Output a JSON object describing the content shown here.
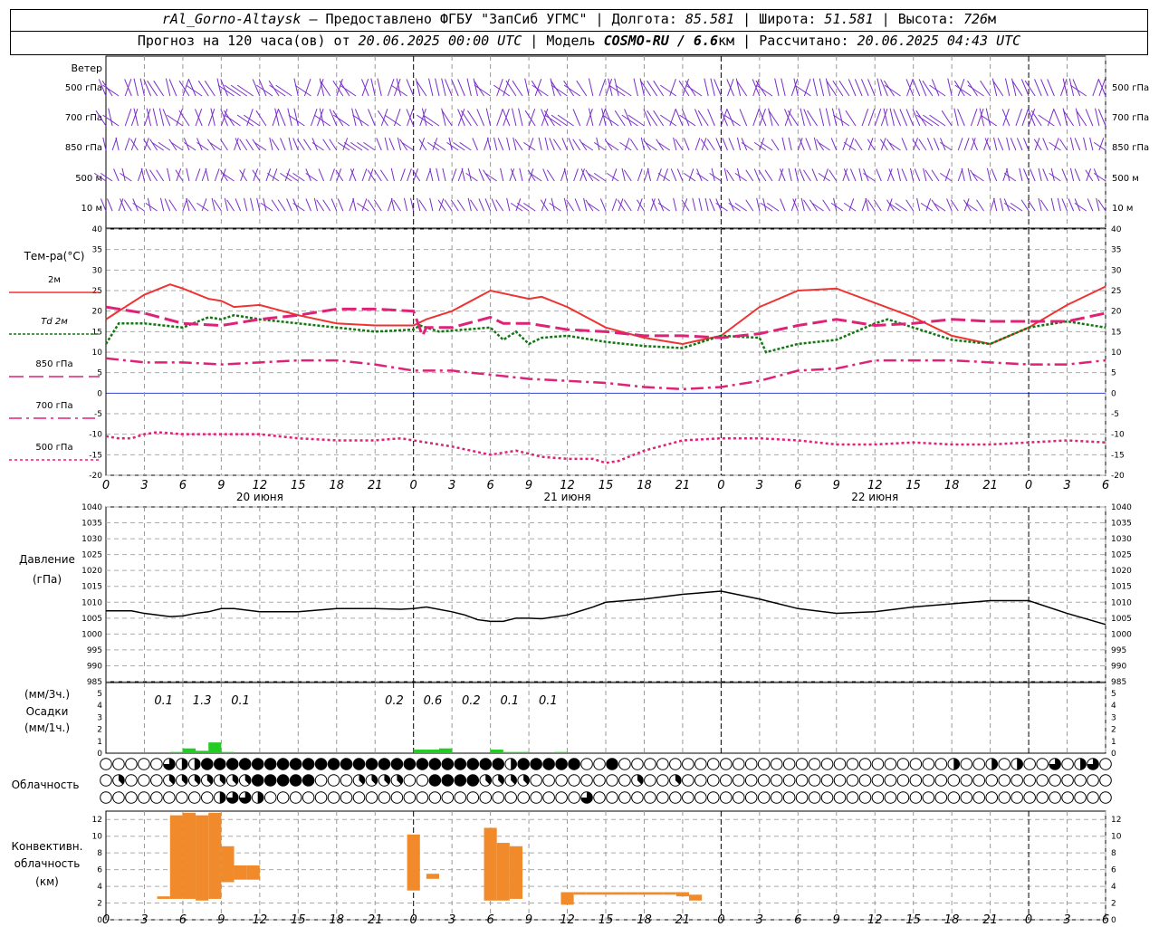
{
  "header": {
    "station": "rAl_Gorno-Altaysk",
    "provider": "— Предоставлено ФГБУ \"ЗапСиб УГМС\"",
    "lon_label": "Долгота:",
    "lon_value": "85.581",
    "lat_label": "Широта:",
    "lat_value": "51.581",
    "alt_label": "Высота:",
    "alt_value": "726",
    "alt_unit": "м",
    "forecast_prefix": "Прогноз на 120 часа(ов) от",
    "forecast_start": "20.06.2025 00:00 UTC",
    "model_label": "Модель",
    "model_name": "COSMO-RU / 6.6",
    "model_unit": "км",
    "calc_label": "Рассчитано:",
    "calc_time": "20.06.2025 04:43 UTC"
  },
  "wind_panel": {
    "title": "Ветер",
    "levels": [
      "500 гПа",
      "700 гПа",
      "850 гПа",
      "500 м",
      "10 м"
    ]
  },
  "temp_panel": {
    "title": "Тем-ра(°C)",
    "legend": [
      {
        "label": "2м",
        "color": "#ee3333",
        "style": "solid"
      },
      {
        "label": "Td  2м",
        "color": "#117711",
        "style": "dotted"
      },
      {
        "label": "850 гПа",
        "color": "#dd2277",
        "style": "dash"
      },
      {
        "label": "700 гПа",
        "color": "#dd2277",
        "style": "dashdot"
      },
      {
        "label": "500 гПа",
        "color": "#dd2277",
        "style": "dot"
      }
    ]
  },
  "pressure_panel": {
    "title": "Давление",
    "unit": "(гПа)"
  },
  "precip_panel": {
    "unit_top": "(мм/3ч.)",
    "title": "Осадки",
    "unit_bottom": "(мм/1ч.)"
  },
  "cloud_panel": {
    "title": "Облачность"
  },
  "conv_panel": {
    "title1": "Конвективн.",
    "title2": "облачность",
    "unit": "(км)"
  },
  "x_axis": {
    "hour_labels": [
      "0",
      "3",
      "6",
      "9",
      "12",
      "15",
      "18",
      "21",
      "0",
      "3",
      "6",
      "9",
      "12",
      "15",
      "18",
      "21",
      "0",
      "3",
      "6",
      "9",
      "12",
      "15",
      "18",
      "21",
      "0",
      "3",
      "6"
    ],
    "day_labels": [
      "20 июня",
      "21 июня",
      "22 июня"
    ]
  },
  "chart_data": [
    {
      "type": "line",
      "title": "Тем-ра(°C)",
      "x_unit": "hours since 20.06.2025 00:00 UTC",
      "ylim": [
        -20,
        40
      ],
      "yticks": [
        -20,
        -15,
        -10,
        -5,
        0,
        5,
        10,
        15,
        20,
        25,
        30,
        35,
        40
      ],
      "series": [
        {
          "name": "2м",
          "x": [
            0,
            3,
            5,
            6,
            8,
            9,
            10,
            12,
            15,
            18,
            21,
            24,
            25,
            27,
            30,
            33,
            34,
            36,
            39,
            42,
            45,
            48,
            51,
            54,
            57,
            60,
            63,
            66,
            69,
            72,
            75,
            78
          ],
          "values": [
            18,
            24,
            26.5,
            25.5,
            23,
            22.5,
            21,
            21.5,
            19,
            17,
            16.5,
            16.5,
            18,
            20,
            25,
            23,
            23.5,
            21,
            16,
            13.5,
            12,
            14,
            21,
            25,
            25.5,
            22,
            18.5,
            14,
            12,
            16,
            21.5,
            26
          ]
        },
        {
          "name": "Td 2м",
          "x": [
            0,
            1,
            3,
            6,
            8,
            9,
            10,
            12,
            15,
            18,
            21,
            24,
            24.5,
            26,
            30,
            31,
            32,
            33,
            34,
            36,
            39,
            42,
            45,
            48,
            51,
            51.5,
            54,
            57,
            60,
            61,
            63,
            66,
            69,
            72,
            75,
            78
          ],
          "values": [
            12,
            17,
            17,
            16,
            18.5,
            18,
            19,
            18,
            17,
            16,
            15,
            15.5,
            16.5,
            15,
            16,
            13,
            15,
            12,
            13.5,
            14,
            12.5,
            11.5,
            11,
            14,
            13.5,
            10,
            12,
            13,
            17,
            18,
            16,
            13,
            12,
            16,
            17.5,
            16
          ]
        },
        {
          "name": "850 гПа",
          "x": [
            0,
            3,
            6,
            9,
            12,
            15,
            18,
            21,
            24,
            24.7,
            25,
            27,
            30,
            31,
            33,
            36,
            39,
            42,
            45,
            48,
            51,
            54,
            57,
            60,
            63,
            66,
            69,
            72,
            75,
            78
          ],
          "values": [
            21,
            19.5,
            17,
            16.5,
            18,
            19,
            20.5,
            20.5,
            20,
            14,
            16,
            16,
            18.5,
            17,
            17,
            15.5,
            15,
            14,
            14,
            13.5,
            14.5,
            16.5,
            18,
            16.5,
            17,
            18,
            17.5,
            17.5,
            17.5,
            19.5
          ]
        },
        {
          "name": "700 гПа",
          "x": [
            0,
            3,
            6,
            9,
            12,
            15,
            18,
            21,
            24,
            27,
            30,
            33,
            36,
            39,
            42,
            45,
            48,
            51,
            54,
            57,
            60,
            63,
            66,
            69,
            72,
            75,
            78
          ],
          "values": [
            8.5,
            7.5,
            7.5,
            7,
            7.5,
            8,
            8,
            7,
            5.5,
            5.5,
            4.5,
            3.5,
            3,
            2.5,
            1.5,
            1,
            1.5,
            3,
            5.5,
            6,
            8,
            8,
            8,
            7.5,
            7,
            7,
            8
          ]
        },
        {
          "name": "500 гПа",
          "x": [
            0,
            1,
            2,
            3,
            4,
            6,
            9,
            12,
            15,
            18,
            21,
            23,
            24,
            27,
            30,
            32,
            34,
            36,
            38,
            39,
            40,
            42,
            45,
            48,
            51,
            54,
            57,
            60,
            63,
            66,
            69,
            72,
            75,
            78
          ],
          "values": [
            -10.5,
            -11,
            -11,
            -10,
            -9.5,
            -10,
            -10,
            -10,
            -11,
            -11.5,
            -11.5,
            -11,
            -11.5,
            -13,
            -15,
            -14,
            -15.5,
            -16,
            -16,
            -17,
            -16.5,
            -14,
            -11.5,
            -11,
            -11,
            -11.5,
            -12.5,
            -12.5,
            -12,
            -12.5,
            -12.5,
            -12,
            -11.5,
            -12
          ]
        }
      ]
    },
    {
      "type": "line",
      "title": "Давление",
      "ylabel": "(гПа)",
      "ylim": [
        985,
        1040
      ],
      "yticks": [
        985,
        990,
        995,
        1000,
        1005,
        1010,
        1015,
        1020,
        1025,
        1030,
        1035,
        1040
      ],
      "series": [
        {
          "x": [
            0,
            2,
            3,
            5,
            6,
            7,
            8,
            9,
            10,
            12,
            15,
            18,
            21,
            23,
            24,
            25,
            27,
            28,
            29,
            30,
            31,
            32,
            33,
            34,
            36,
            38,
            39,
            42,
            45,
            48,
            51,
            54,
            57,
            60,
            63,
            66,
            69,
            72,
            75,
            78
          ],
          "values": [
            1007.3,
            1007.3,
            1006.5,
            1005.5,
            1005.7,
            1006.5,
            1007,
            1008,
            1008,
            1007,
            1007,
            1008,
            1008,
            1007.8,
            1008,
            1008.5,
            1007,
            1006,
            1004.5,
            1004,
            1004,
            1005,
            1005,
            1004.8,
            1006,
            1008.5,
            1010,
            1011,
            1012.5,
            1013.5,
            1011,
            1008,
            1006.5,
            1007,
            1008.5,
            1009.5,
            1010.5,
            1010.5,
            1006.5,
            1003
          ]
        }
      ]
    },
    {
      "type": "bar",
      "title": "Осадки",
      "ylabel": "(мм/1ч.)",
      "ylim": [
        0,
        5
      ],
      "yticks": [
        0,
        1,
        2,
        3,
        4,
        5
      ],
      "x": [
        5,
        6,
        7,
        8,
        9,
        24,
        25,
        26,
        30,
        31,
        32,
        35
      ],
      "values": [
        0.1,
        0.4,
        0.2,
        0.9,
        0.1,
        0.3,
        0.3,
        0.4,
        0.3,
        0.1,
        0.1,
        0.1
      ],
      "labels_3h": [
        {
          "x": 4.5,
          "text": "0.1"
        },
        {
          "x": 7.5,
          "text": "1.3"
        },
        {
          "x": 10.5,
          "text": "0.1"
        },
        {
          "x": 22.5,
          "text": "0.2"
        },
        {
          "x": 25.5,
          "text": "0.6"
        },
        {
          "x": 28.5,
          "text": "0.2"
        },
        {
          "x": 31.5,
          "text": "0.1"
        },
        {
          "x": 34.5,
          "text": "0.1"
        }
      ]
    },
    {
      "type": "bar",
      "title": "Облачность",
      "rows": 3,
      "x_start": 0,
      "x_end": 78,
      "row_high_fill_eighths": [
        0,
        0,
        0,
        0,
        0,
        6,
        4,
        4,
        8,
        8,
        8,
        8,
        8,
        8,
        8,
        8,
        8,
        8,
        8,
        8,
        8,
        8,
        8,
        8,
        8,
        8,
        8,
        8,
        8,
        8,
        8,
        8,
        4,
        8,
        8,
        8,
        8,
        8,
        0,
        0,
        8,
        0,
        0,
        0,
        0,
        0,
        0,
        0,
        0,
        0,
        0,
        0,
        0,
        0,
        0,
        0,
        0,
        0,
        0,
        0,
        0,
        0,
        0,
        0,
        0,
        0,
        0,
        4,
        0,
        0,
        4,
        0,
        4,
        0,
        0,
        6,
        0,
        4,
        6,
        0
      ],
      "row_mid_fill_eighths": [
        0,
        3,
        0,
        0,
        0,
        3,
        3,
        3,
        3,
        3,
        3,
        3,
        8,
        8,
        8,
        8,
        8,
        0,
        0,
        0,
        3,
        3,
        3,
        3,
        0,
        0,
        8,
        8,
        8,
        8,
        3,
        3,
        3,
        3,
        0,
        0,
        0,
        0,
        0,
        0,
        0,
        0,
        3,
        0,
        0,
        3,
        0,
        0,
        0,
        0,
        0,
        0,
        0,
        0,
        0,
        0,
        0,
        0,
        0,
        0,
        0,
        0,
        0,
        0,
        0,
        0,
        0,
        0,
        0,
        0,
        0,
        0,
        0,
        0,
        0,
        0,
        0,
        0,
        0,
        0
      ],
      "row_low_fill_eighths": [
        0,
        0,
        0,
        0,
        0,
        0,
        0,
        0,
        0,
        4,
        6,
        6,
        4,
        0,
        0,
        0,
        0,
        0,
        0,
        0,
        0,
        0,
        0,
        0,
        0,
        0,
        0,
        0,
        0,
        0,
        0,
        0,
        0,
        0,
        0,
        0,
        0,
        0,
        6,
        0,
        0,
        0,
        0,
        0,
        0,
        0,
        0,
        0,
        0,
        0,
        0,
        0,
        0,
        0,
        0,
        0,
        0,
        0,
        0,
        0,
        0,
        0,
        0,
        0,
        0,
        0,
        0,
        0,
        0,
        0,
        0,
        0,
        0,
        0,
        0,
        0,
        0,
        0,
        0,
        0
      ]
    },
    {
      "type": "bar",
      "title": "Конвективн. облачность",
      "ylabel": "(км)",
      "ylim": [
        0,
        13
      ],
      "yticks": [
        0,
        2,
        4,
        6,
        8,
        10,
        12
      ],
      "x": [
        4.5,
        5.5,
        6.5,
        7.5,
        8.5,
        9.5,
        10.5,
        11.5,
        24,
        25.5,
        30,
        31,
        32,
        36,
        37,
        38,
        39,
        40,
        41,
        42,
        43,
        44,
        45,
        46
      ],
      "base": [
        2.5,
        2.5,
        2.5,
        2.3,
        2.5,
        4.5,
        4.8,
        4.8,
        3.5,
        4.9,
        2.3,
        2.3,
        2.5,
        1.8,
        3,
        3,
        3,
        3,
        3,
        3,
        3,
        3,
        2.8,
        2.3
      ],
      "top": [
        2.8,
        12.5,
        12.8,
        12.5,
        12.8,
        8.8,
        6.5,
        6.5,
        10.2,
        5.5,
        11.0,
        9.2,
        8.8,
        3.3,
        3.3,
        3.3,
        3.3,
        3.3,
        3.3,
        3.3,
        3.3,
        3.3,
        3.3,
        3.0
      ]
    }
  ]
}
